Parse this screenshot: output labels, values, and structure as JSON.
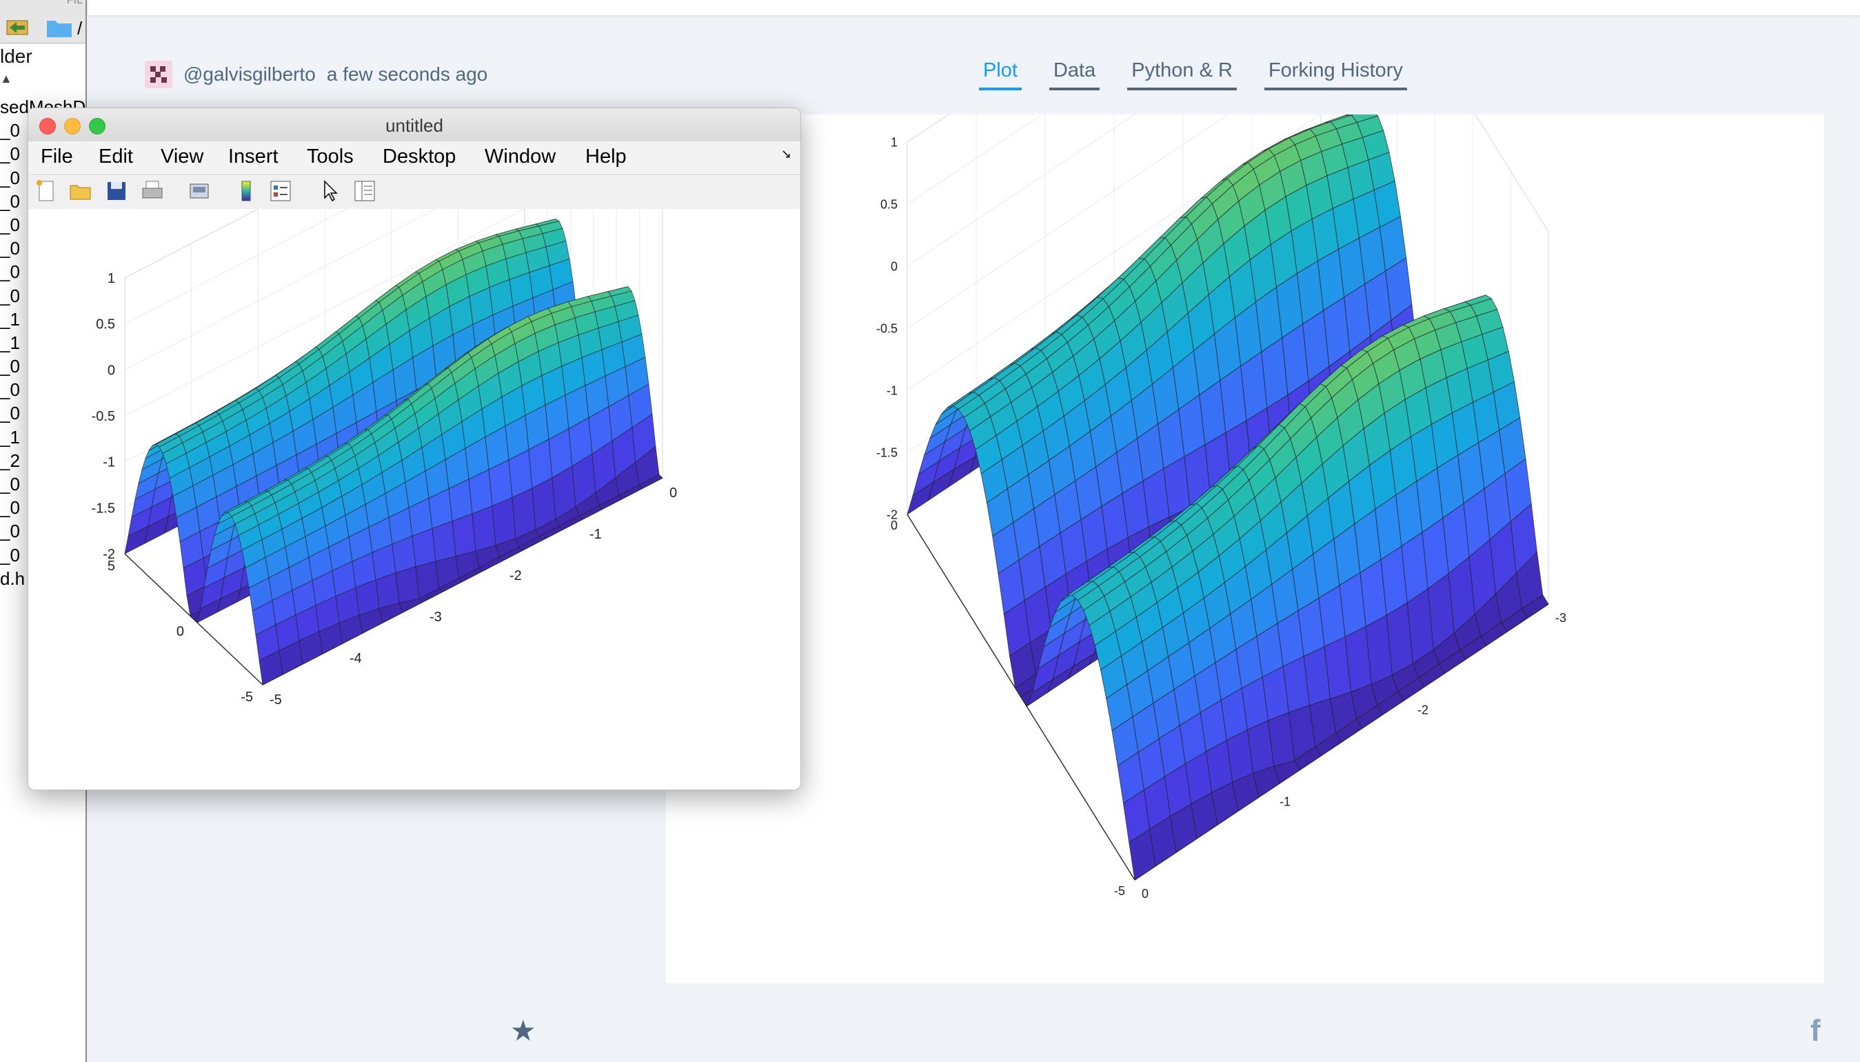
{
  "left_pane": {
    "top_text": "FIL",
    "folder_path": "/",
    "header": "lder",
    "rows": [
      "sedMeshD",
      "_0",
      "_0",
      "_0",
      "_0",
      "_0",
      "_0",
      "_0",
      "_0",
      "_1",
      "_1",
      "_0",
      "_0",
      "_0",
      "_1",
      "_2",
      "_0",
      "_0",
      "_0",
      "_0",
      "d.h"
    ]
  },
  "plotly": {
    "author": "@galvisgilberto",
    "time": "a few seconds ago",
    "tabs": [
      {
        "label": "Plot",
        "active": true
      },
      {
        "label": "Data",
        "active": false
      },
      {
        "label": "Python & R",
        "active": false
      },
      {
        "label": "Forking History",
        "active": false
      }
    ],
    "star_icon": "star-icon",
    "facebook_glyph": "f"
  },
  "matlab": {
    "title": "untitled",
    "menus": [
      "File",
      "Edit",
      "View",
      "Insert",
      "Tools",
      "Desktop",
      "Window",
      "Help"
    ],
    "toolbar_icons": [
      "new-figure-icon",
      "open-file-icon",
      "save-icon",
      "print-icon",
      "link-icon",
      "colorbar-icon",
      "legend-icon",
      "pointer-icon",
      "property-inspector-icon"
    ]
  },
  "colors": {
    "plotly_blue": "#119dff",
    "plotly_text": "#506784",
    "parula_low": "#3e26a8",
    "parula_high": "#f9fb0e"
  },
  "chart_data": [
    {
      "type": "surface",
      "title": "",
      "x_ticks": [
        "-5",
        "-4",
        "-3",
        "-2",
        "-1",
        "0"
      ],
      "y_ticks": [
        "5",
        "0",
        "-5"
      ],
      "z_ticks": [
        "1",
        "0.5",
        "0",
        "-0.5",
        "-1",
        "-1.5",
        "-2"
      ],
      "xlim": [
        -5,
        0
      ],
      "ylim": [
        -5,
        5
      ],
      "zlim": [
        -2,
        1
      ],
      "colormap": "parula",
      "grid": true
    },
    {
      "type": "surface",
      "title": "",
      "x_ticks": [
        "0",
        "-1",
        "-2",
        "-3"
      ],
      "y_ticks": [
        "0",
        "-5"
      ],
      "z_ticks": [
        "1",
        "0.5",
        "0",
        "-0.5",
        "-1",
        "-1.5",
        "-2"
      ],
      "xlim": [
        -5,
        0
      ],
      "ylim": [
        -5,
        5
      ],
      "zlim": [
        -2,
        1
      ],
      "colormap": "parula",
      "grid": true
    }
  ]
}
